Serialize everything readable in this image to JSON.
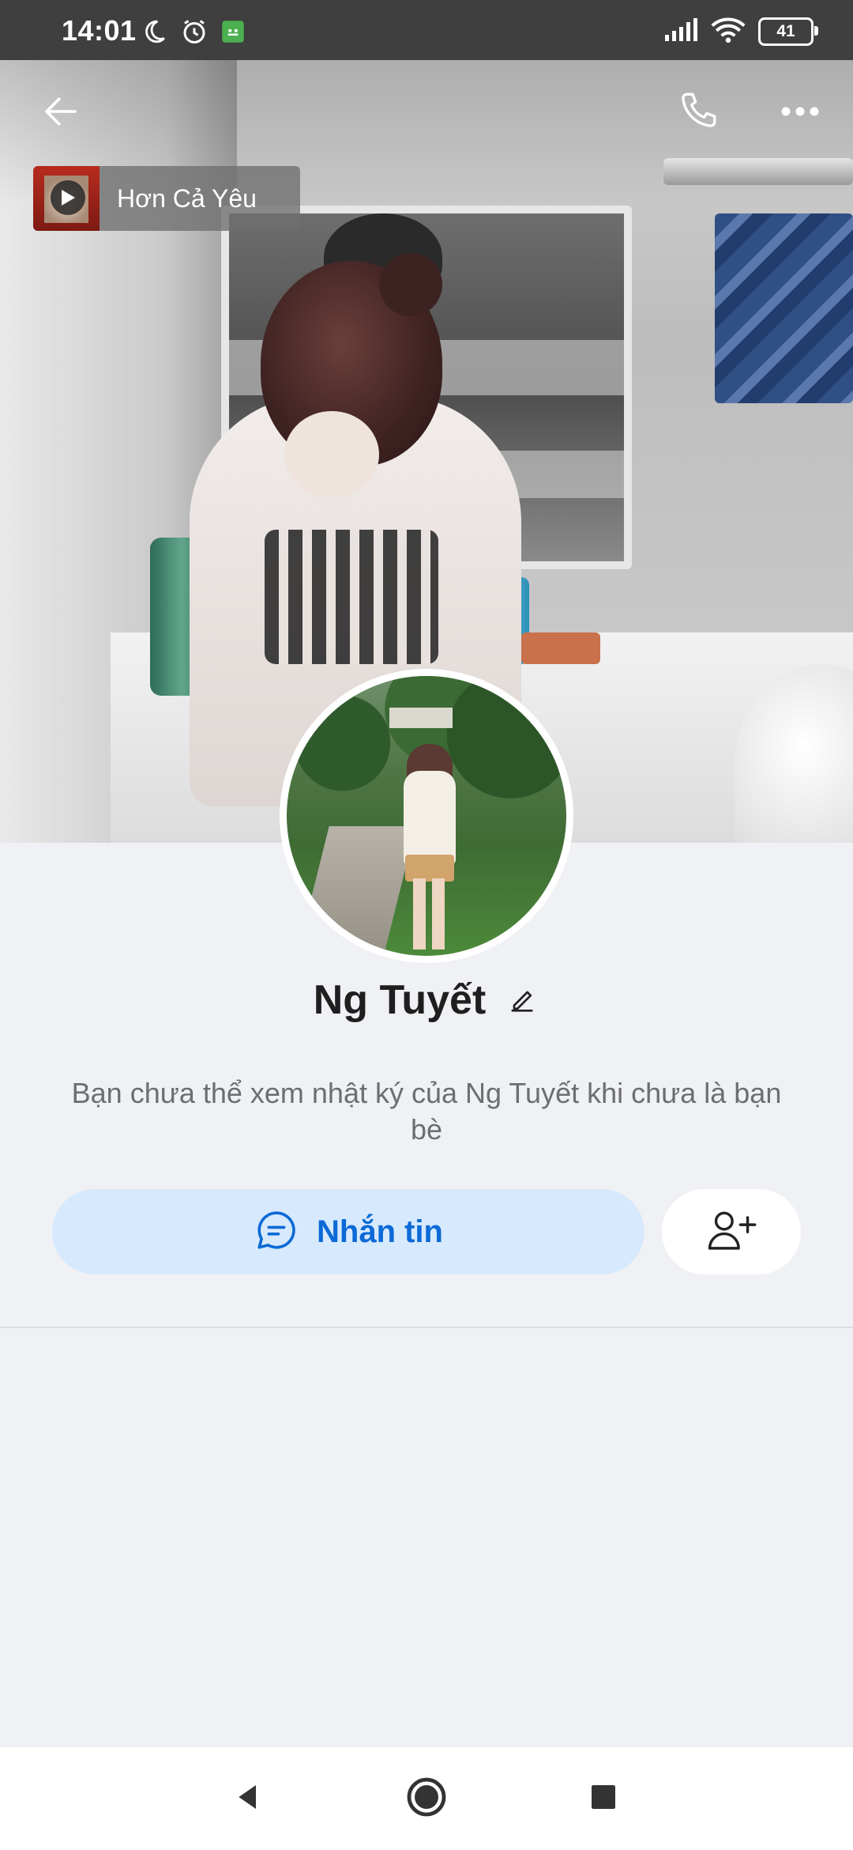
{
  "status_bar": {
    "time": "14:01",
    "battery": "41",
    "left_icons": [
      "moon-icon",
      "alarm-icon",
      "app-notification-icon"
    ],
    "right_icons": [
      "signal-icon",
      "wifi-icon",
      "battery-icon"
    ]
  },
  "toolbar": {
    "back_icon": "arrow-left-icon",
    "call_icon": "phone-icon",
    "more_icon": "more-horizontal-icon"
  },
  "music": {
    "title": "Hơn Cả Yêu",
    "play_icon": "play-icon"
  },
  "profile": {
    "name": "Ng Tuyết",
    "edit_icon": "pencil-icon",
    "privacy_note": "Bạn chưa thể xem nhật ký của Ng Tuyết khi chưa là bạn bè"
  },
  "actions": {
    "message_label": "Nhắn tin",
    "message_icon": "chat-bubble-icon",
    "add_friend_icon": "add-user-icon"
  },
  "colors": {
    "accent": "#0b6ad6",
    "message_button_bg": "#d7e9fc",
    "page_bg": "#f0f1f5"
  }
}
